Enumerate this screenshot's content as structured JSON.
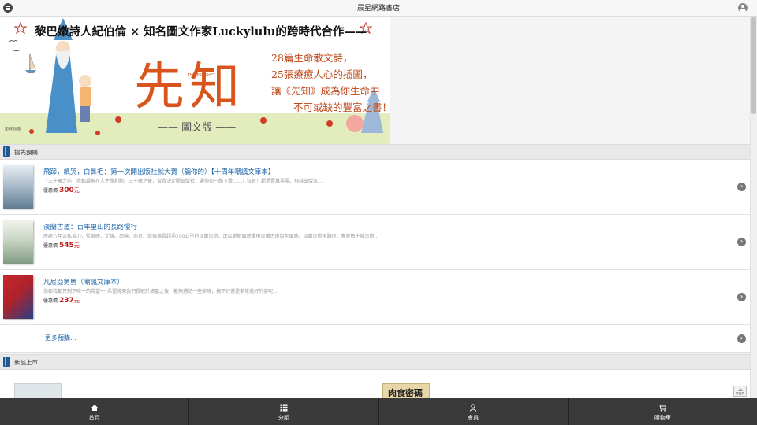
{
  "header": {
    "title": "晨星網路書店"
  },
  "banner": {
    "headline": "黎巴嫩詩人紀伯倫 × 知名圖文作家Luckylulu的跨時代合作——",
    "big_title": "先知",
    "subtitle_small": "THE PROPHET",
    "tagline": [
      "28篇生命散文詩，",
      "25張療癒人心的插圖，",
      "讓《先知》成為你生命中",
      "不可或缺的豐富之書！"
    ],
    "edition": "—— 圖文版 ——",
    "publisher": "愛米粒出版"
  },
  "preorder": {
    "label": "搶先預購",
    "items": [
      {
        "title": "飛蹄，飆哭，白鼻毛：第一次開出版社就大賣（騙你的）【十周年嘲諷文庫本】",
        "desc": "「三十歲之前，我都誤解在人生勝利組。三十歲之後，當我決定開出版社，運勢卻一路下滑……」狂賀！超過賣萬零零、飛越出版法…",
        "price_prefix": "優惠價",
        "price": "300",
        "unit": "元"
      },
      {
        "title": "淡蘭古道：百年里山的長路慢行",
        "desc": "歷經六年公私協力，從調研、定線、串聯、命名、這條條長超過200公里的淡蘭古道，正以嶄新面貌重現淡蘭古道百年風華。淡蘭古道全路徑，實穿數十條古道…",
        "price_prefix": "優惠價",
        "price": "545",
        "unit": "元"
      },
      {
        "title": "凡尼亞舅舅（嘲諷文庫本）",
        "desc": "你和我都只剩下唯一的希望── 希望將來我們長眠於墳墓之後，能夠遇訪一些夢境，搞不好還是非常美好的夢呢…",
        "price_prefix": "優惠價",
        "price": "237",
        "unit": "元"
      }
    ],
    "more_label": "更多預購..."
  },
  "new_arrivals": {
    "label": "新品上市",
    "cover_b_text": "肉食密碼"
  },
  "top_button": "TOP",
  "bottom_nav": [
    {
      "label": "首頁",
      "icon": "home-icon"
    },
    {
      "label": "分類",
      "icon": "grid-icon"
    },
    {
      "label": "會員",
      "icon": "user-icon"
    },
    {
      "label": "購物車",
      "icon": "cart-icon"
    }
  ],
  "colors": {
    "link": "#1a63a6",
    "price": "#c01818",
    "banner_accent": "#d8561d",
    "nav_bg": "#3a3a3a"
  }
}
